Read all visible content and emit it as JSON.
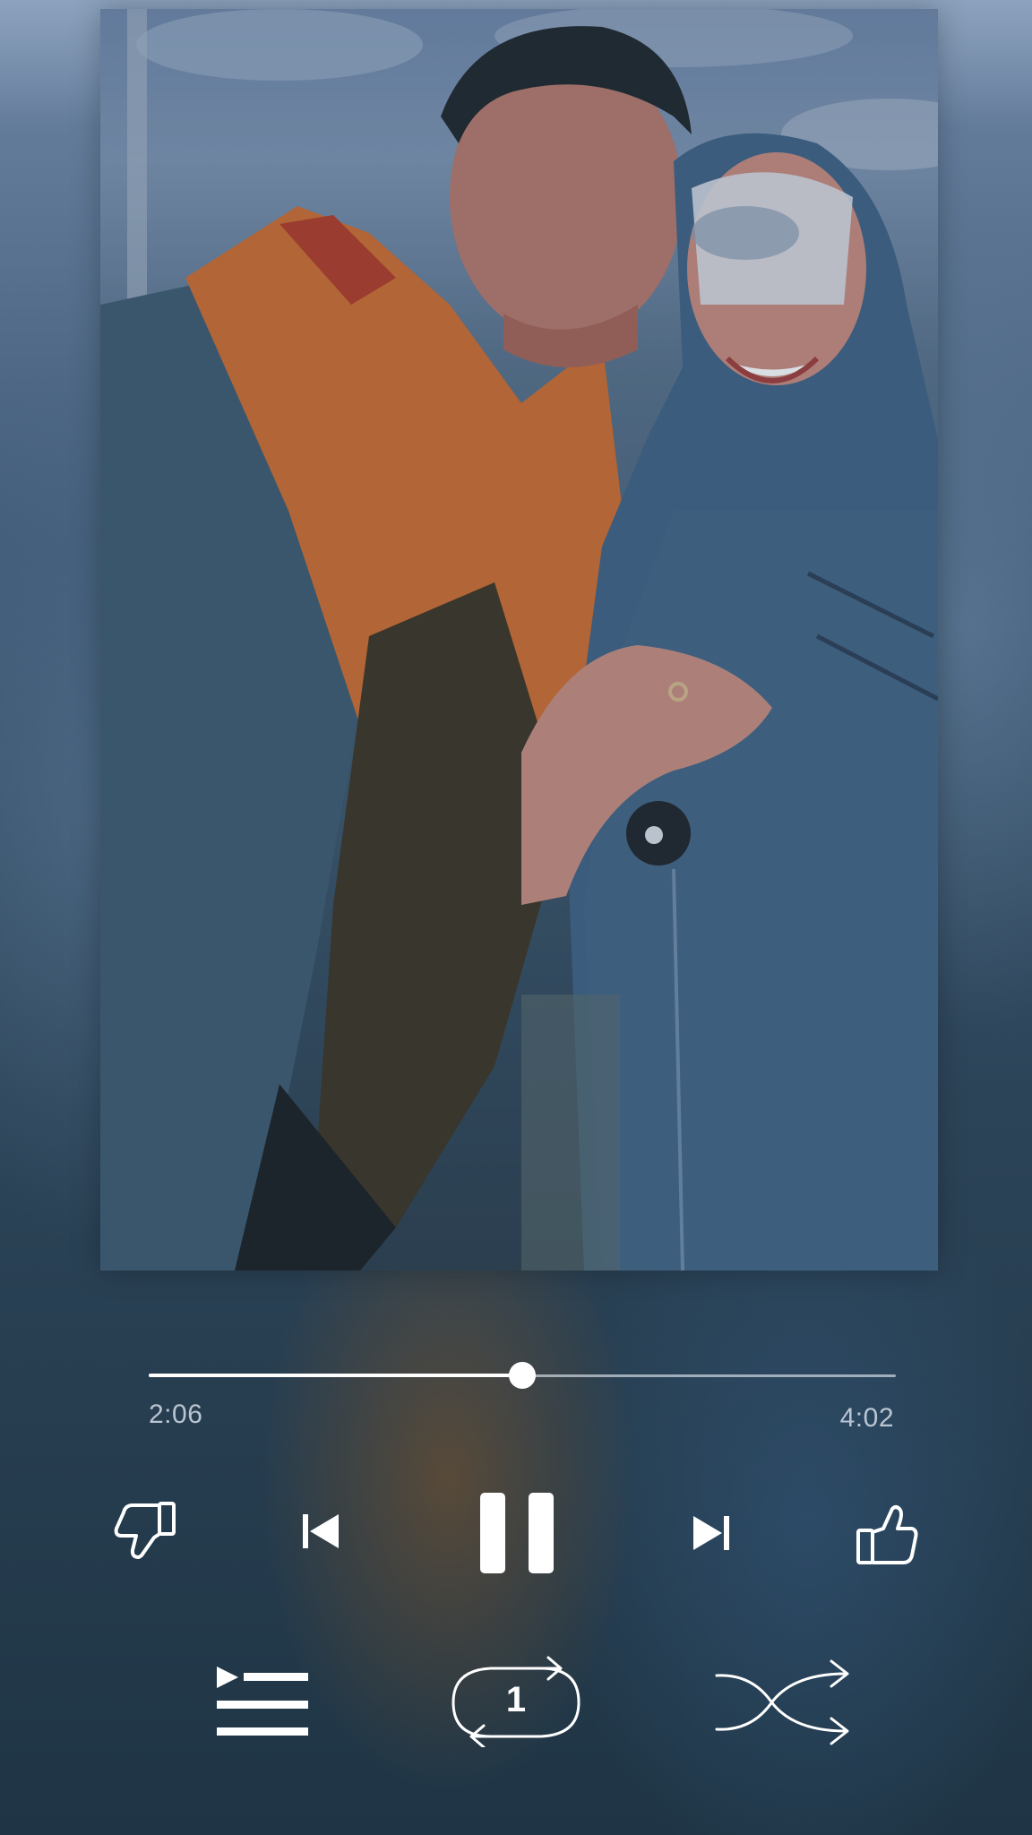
{
  "player": {
    "elapsed": "2:06",
    "total": "4:02",
    "progress_fraction": 0.5,
    "repeat_count": "1"
  },
  "icons": {
    "dislike": "thumbs-down-icon",
    "previous": "skip-previous-icon",
    "pause": "pause-icon",
    "next": "skip-next-icon",
    "like": "thumbs-up-icon",
    "queue": "queue-icon",
    "repeat": "repeat-one-icon",
    "shuffle": "shuffle-icon"
  },
  "colors": {
    "icon": "#ffffff",
    "track": "#e1e8f0",
    "time_text": "#d2dce6"
  }
}
